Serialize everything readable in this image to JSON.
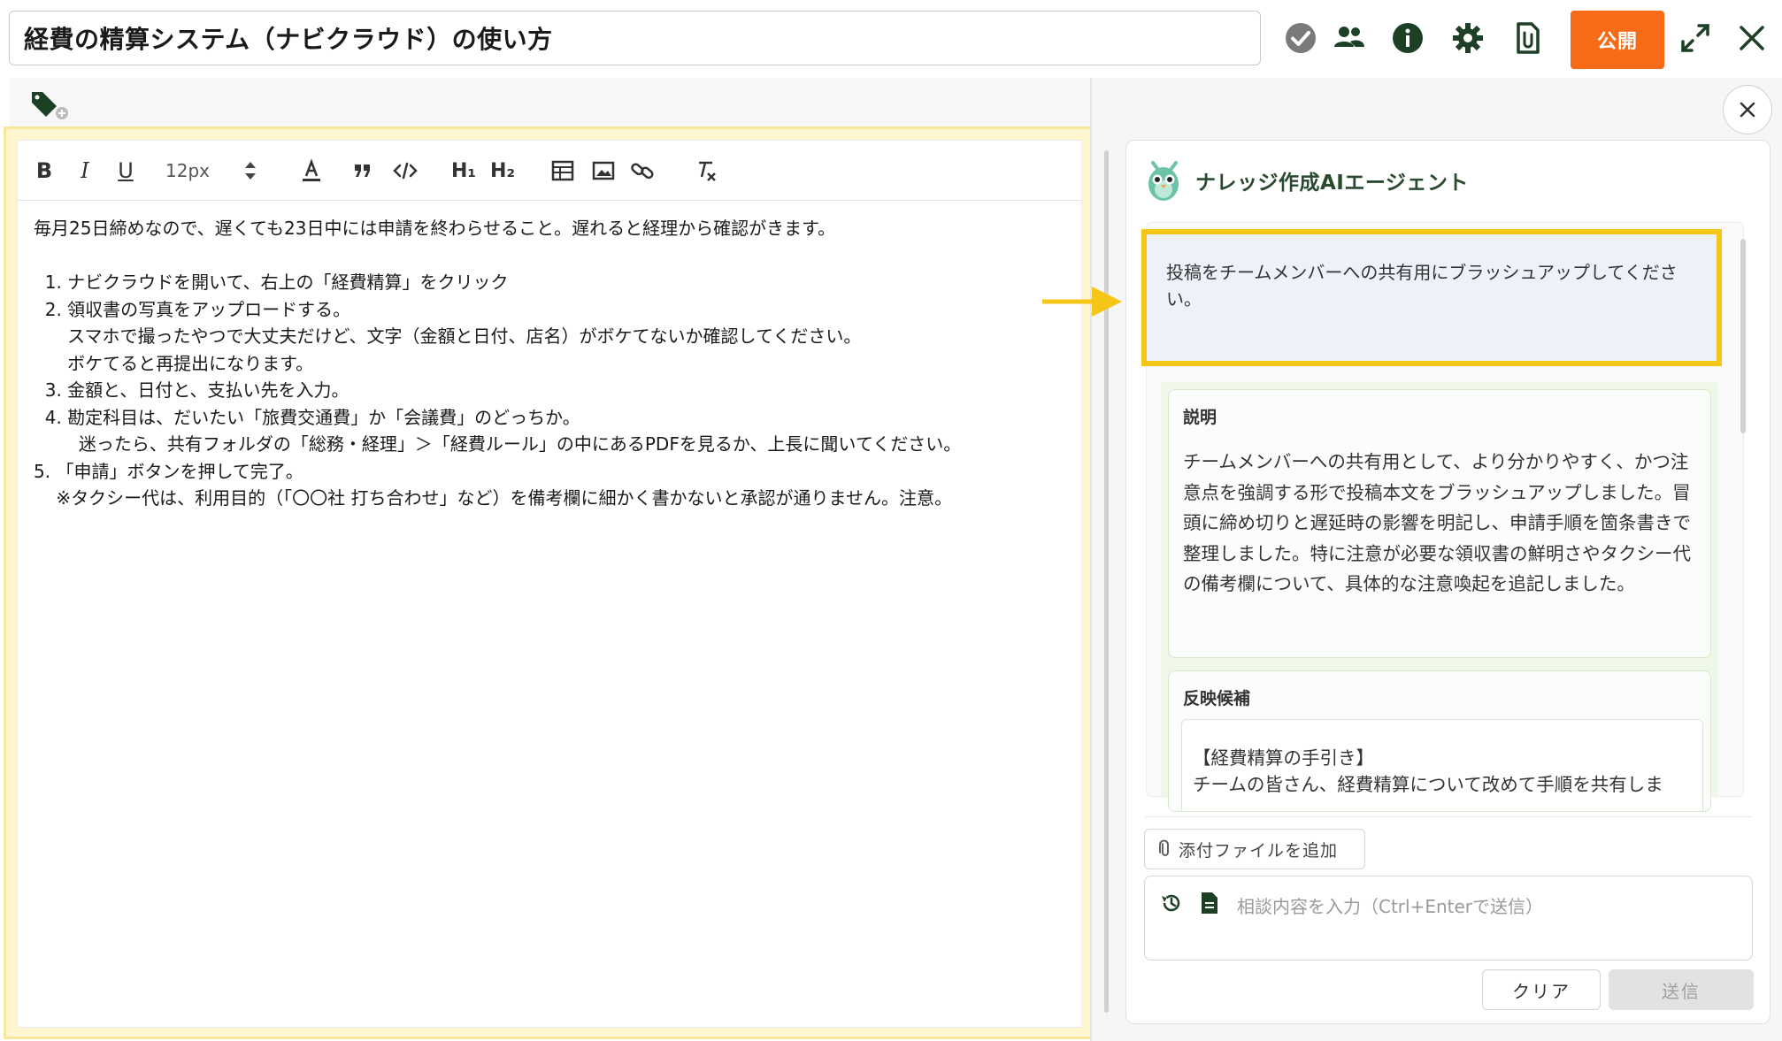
{
  "header": {
    "title": "経費の精算システム（ナビクラウド）の使い方",
    "publish_label": "公開",
    "icons": [
      "check-circle-icon",
      "members-icon",
      "info-icon",
      "gear-icon",
      "attachment-doc-icon",
      "expand-icon",
      "close-icon"
    ]
  },
  "tags": {
    "icon": "tag-add-icon"
  },
  "toolbar": {
    "bold": "B",
    "italic": "I",
    "underline": "U",
    "font_size": "12px",
    "h1": "H₁",
    "h2": "H₂",
    "icons": [
      "bold-icon",
      "italic-icon",
      "underline-icon",
      "font-size-stepper-icon",
      "text-color-icon",
      "quote-icon",
      "code-icon",
      "table-icon",
      "image-icon",
      "link-icon",
      "clear-format-icon"
    ]
  },
  "editor": {
    "lines": [
      "毎月25日締めなので、遅くても23日中には申請を終わらせること。遅れると経理から確認がきます。",
      "",
      "  1. ナビクラウドを開いて、右上の「経費精算」をクリック",
      "  2. 領収書の写真をアップロードする。",
      "      スマホで撮ったやつで大丈夫だけど、文字（金額と日付、店名）がボケてないか確認してください。",
      "      ボケてると再提出になります。",
      "  3. 金額と、日付と、支払い先を入力。",
      "  4. 勘定科目は、だいたい「旅費交通費」か「会議費」のどっちか。",
      "        迷ったら、共有フォルダの「総務・経理」＞「経費ルール」の中にあるPDFを見るか、上長に聞いてください。",
      "5. 「申請」ボタンを押して完了。",
      "    ※タクシー代は、利用目的（「〇〇社 打ち合わせ」など）を備考欄に細かく書かないと承認が通りません。注意。"
    ]
  },
  "ai_panel": {
    "title": "ナレッジ作成AIエージェント",
    "user_message": "投稿をチームメンバーへの共有用にブラッシュアップしてください。",
    "explanation_heading": "説明",
    "explanation_text": "チームメンバーへの共有用として、より分かりやすく、かつ注意点を強調する形で投稿本文をブラッシュアップしました。冒頭に締め切りと遅延時の影響を明記し、申請手順を箇条書きで整理しました。特に注意が必要な領収書の鮮明さやタクシー代の備考欄について、具体的な注意喚起を追記しました。",
    "candidate_heading": "反映候補",
    "candidate_text": "【経費精算の手引き】\nチームの皆さん、経費精算について改めて手順を共有しま",
    "attach_label": "添付ファイルを追加",
    "input_placeholder": "相談内容を入力（Ctrl+Enterで送信）",
    "clear_label": "クリア",
    "send_label": "送信"
  },
  "colors": {
    "publish": "#f76a16",
    "highlight": "#f5c518",
    "editor_highlight": "#fdf6cf",
    "ai_title": "#2a4a2f",
    "response_bg": "#eef7e8"
  }
}
